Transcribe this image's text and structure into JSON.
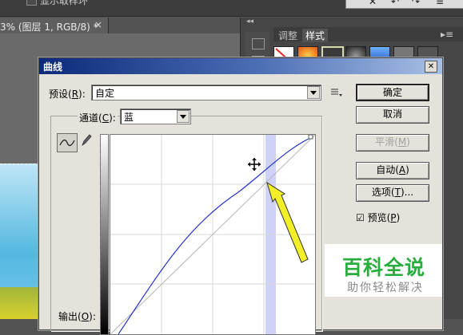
{
  "photoshop": {
    "options_bar": {
      "show_sampling_ring_label": "显示取样环"
    },
    "top_right_toolbar": {
      "glyphs": [
        "✕",
        "↶",
        "↷",
        "≡"
      ]
    },
    "document_tab": {
      "title": "3% (图层 1, RGB/8) *",
      "close": "×"
    },
    "panel_tabs": [
      {
        "label": "调整",
        "active": false
      },
      {
        "label": "样式",
        "active": true
      }
    ],
    "panel_menu": "▸≡",
    "dock_chevrons": "◂◂"
  },
  "dialog": {
    "title": "曲线",
    "close_glyph": "✕",
    "preset": {
      "label_pre": "预设(",
      "label_key": "R",
      "label_post": "):",
      "value": "自定"
    },
    "preset_menu_icon": "preset-options-icon",
    "channel": {
      "label_pre": "通道(",
      "label_key": "C",
      "label_post": "):",
      "value": "蓝"
    },
    "output": {
      "label_pre": "输出(",
      "label_key": "O",
      "label_post": "):"
    },
    "buttons": {
      "ok": "确定",
      "cancel": "取消",
      "smooth": {
        "pre": "平滑(",
        "key": "M",
        "post": ")"
      },
      "auto": {
        "pre": "自动(",
        "key": "A",
        "post": ")"
      },
      "options": {
        "pre": "选项(",
        "key": "T",
        "post": ")..."
      }
    },
    "preview": {
      "checked": true,
      "check_glyph": "☑",
      "pre": "预览(",
      "key": "P",
      "post": ")"
    },
    "colors": {
      "curve": "#2233cc",
      "highlight_band": "#cfd2f7",
      "arrow": "#f2ee27"
    }
  },
  "watermark": {
    "main": "百科全说",
    "sub": "助你轻松解决"
  }
}
